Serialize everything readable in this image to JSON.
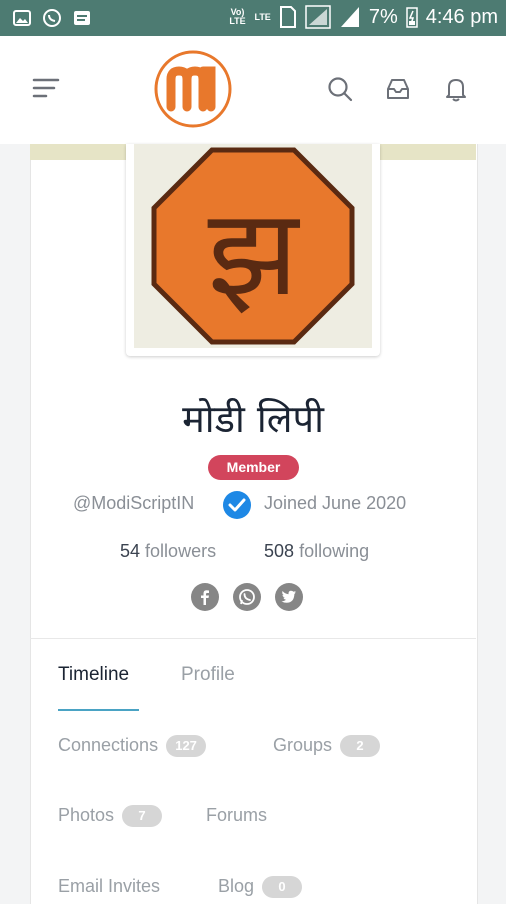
{
  "status_bar": {
    "volte": "Vo) LTE",
    "lte": "LTE",
    "battery_percent": "7%",
    "time": "4:46 pm"
  },
  "app_bar": {
    "logo_letter": "m",
    "icons": [
      "menu-icon",
      "search-icon",
      "inbox-icon",
      "bell-icon"
    ]
  },
  "profile": {
    "avatar_glyph": "झ",
    "name": "मोडी लिपी",
    "badge": "Member",
    "handle": "@ModiScriptIN",
    "joined": "Joined June 2020",
    "followers_count": "54",
    "followers_label": "followers",
    "following_count": "508",
    "following_label": "following"
  },
  "social": [
    "facebook-icon",
    "whatsapp-icon",
    "twitter-icon"
  ],
  "tabs": {
    "timeline": "Timeline",
    "profile": "Profile"
  },
  "nav": {
    "connections": {
      "label": "Connections",
      "count": "127"
    },
    "groups": {
      "label": "Groups",
      "count": "2"
    },
    "photos": {
      "label": "Photos",
      "count": "7"
    },
    "forums": {
      "label": "Forums"
    },
    "email_invites": {
      "label": "Email Invites"
    },
    "blog": {
      "label": "Blog",
      "count": "0"
    }
  },
  "colors": {
    "status_bar": "#4d7b72",
    "brand_orange": "#e8782c",
    "badge_red": "#d2455c",
    "verified_blue": "#1e88e5",
    "tab_accent": "#4aa3c4"
  }
}
